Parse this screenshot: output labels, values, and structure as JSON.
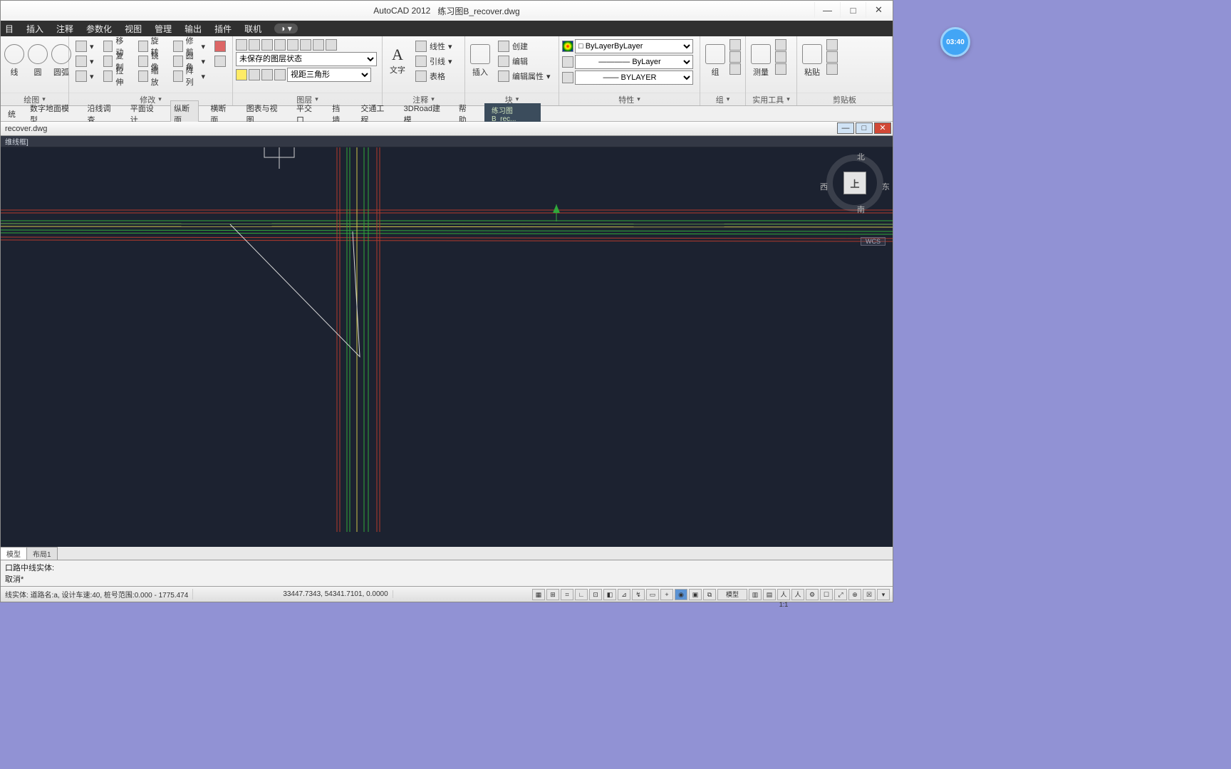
{
  "title": {
    "app": "AutoCAD 2012",
    "file": "练习图B_recover.dwg"
  },
  "win_controls": {
    "min": "—",
    "max": "□",
    "close": "✕"
  },
  "menu": [
    "目",
    "插入",
    "注释",
    "参数化",
    "视图",
    "管理",
    "输出",
    "插件",
    "联机"
  ],
  "ribbon": {
    "draw": {
      "title": "绘图",
      "items": [
        "线",
        "圆",
        "圆弧"
      ]
    },
    "mod": {
      "title": "修改",
      "c1": [
        "移动",
        "复制",
        "拉伸"
      ],
      "c2": [
        "旋转",
        "镜像",
        "缩放"
      ],
      "c3": [
        "修剪",
        "圆角",
        "阵列"
      ]
    },
    "layer": {
      "title": "图层",
      "state": "未保存的图层状态",
      "combo": "视距三角形"
    },
    "anno": {
      "title": "注释",
      "text": "文字",
      "c1": [
        "线性",
        "引线",
        "表格"
      ]
    },
    "block": {
      "title": "块",
      "insert": "插入",
      "c1": [
        "创建",
        "编辑",
        "编辑属性"
      ]
    },
    "prop": {
      "title": "特性",
      "v1": "ByLayer",
      "v2": "ByLayer",
      "v3": "BYLAYER"
    },
    "grp": {
      "title": "组",
      "label": "组"
    },
    "util": {
      "title": "实用工具",
      "label": "测量"
    },
    "clip": {
      "title": "剪贴板",
      "label": "粘贴"
    }
  },
  "sec_menu": [
    "统",
    "数字地面模型",
    "沿线调查",
    "平面设计",
    "纵断面",
    "横断面",
    "图表与视图",
    "平交口",
    "挡墙",
    "交通工程",
    "3DRoad建模",
    "帮助"
  ],
  "file_tab": "练习图B_rec...",
  "doc_title": "recover.dwg",
  "model_label": "维线框]",
  "viewcube": {
    "n": "北",
    "s": "南",
    "e": "东",
    "w": "西",
    "top": "上"
  },
  "wcs": "WCS",
  "layout_tabs": [
    "模型",
    "布局1"
  ],
  "cmd_lines": [
    "口路中线实体:",
    "取消*"
  ],
  "status": {
    "left": "线实体: 道路名:a,  设计车速:40,  桩号范围:0.000 - 1775.474",
    "coords": "33447.7343, 54341.7101, 0.0000",
    "scale": "1:1",
    "model": "模型"
  },
  "timer": "03:40"
}
